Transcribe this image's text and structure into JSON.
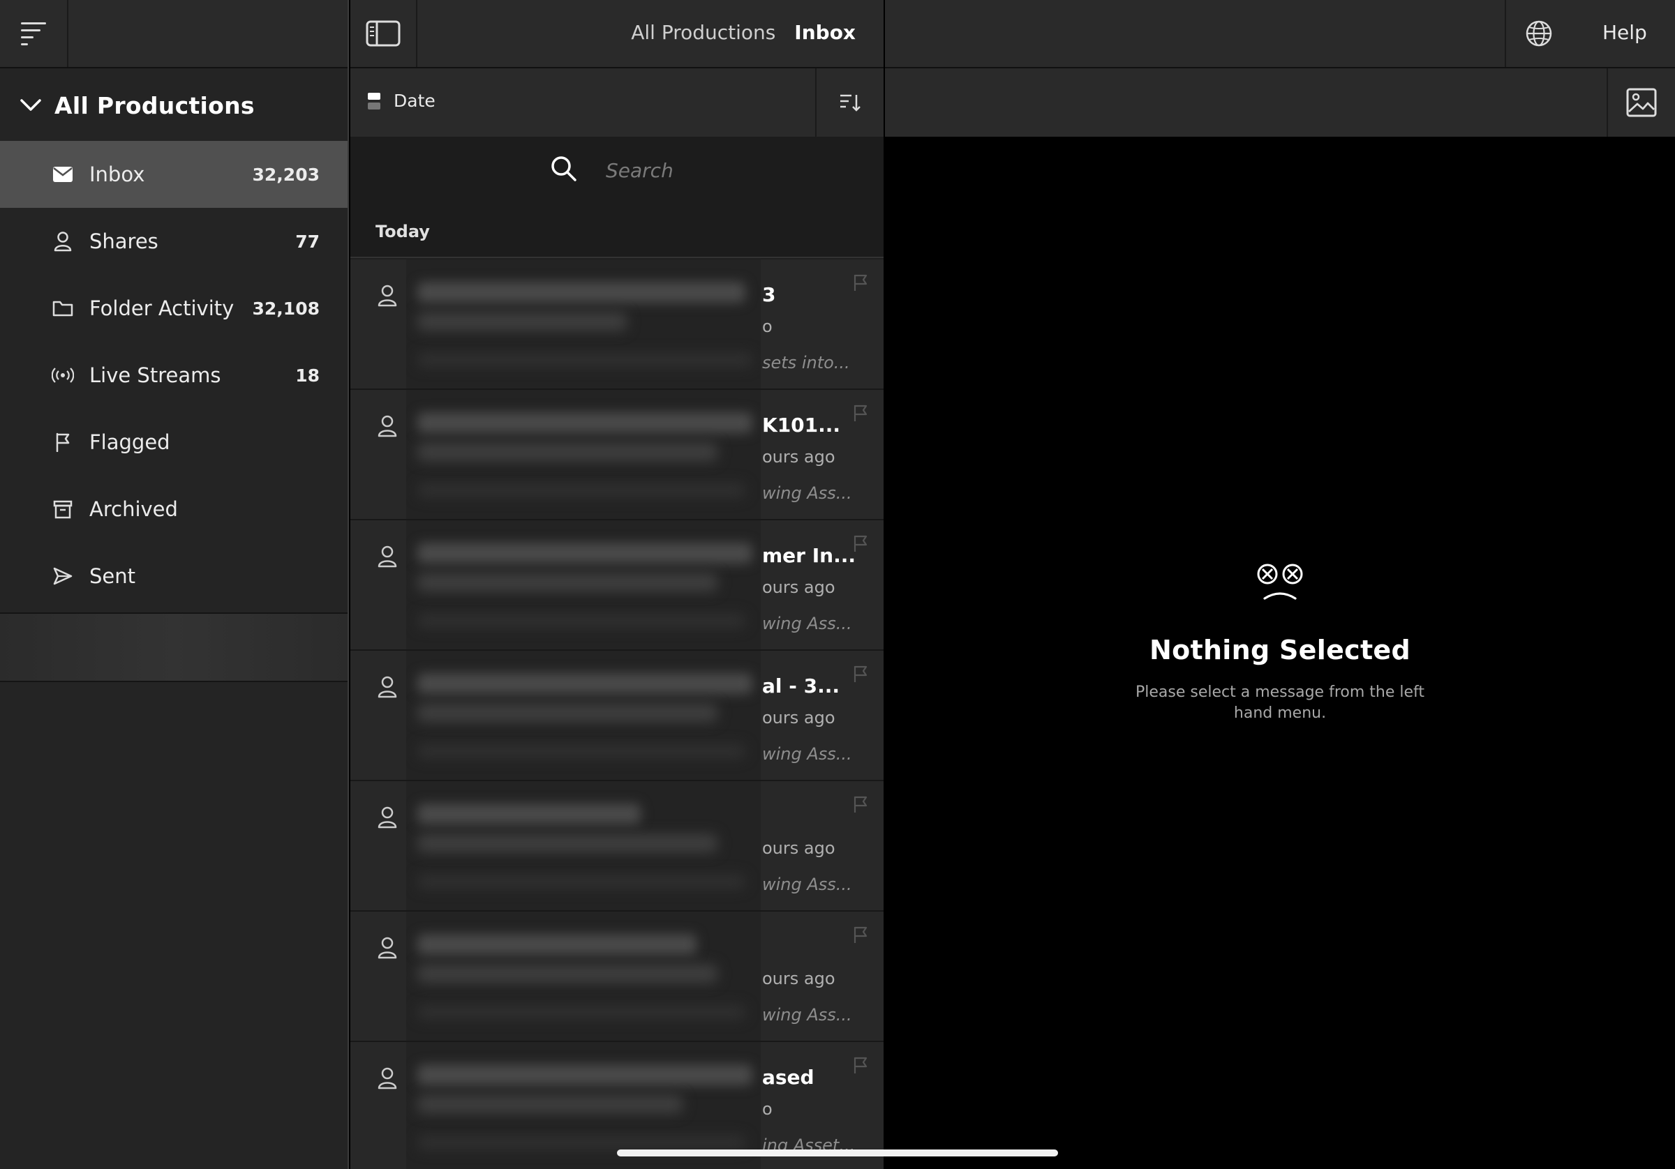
{
  "sidebar": {
    "section_title": "All Productions",
    "items": [
      {
        "label": "Inbox",
        "count": "32,203",
        "icon": "envelope-icon",
        "active": true
      },
      {
        "label": "Shares",
        "count": "77",
        "icon": "person-icon"
      },
      {
        "label": "Folder Activity",
        "count": "32,108",
        "icon": "folder-icon"
      },
      {
        "label": "Live Streams",
        "count": "18",
        "icon": "broadcast-icon"
      },
      {
        "label": "Flagged",
        "count": "",
        "icon": "flag-icon"
      },
      {
        "label": "Archived",
        "count": "",
        "icon": "archive-icon"
      },
      {
        "label": "Sent",
        "count": "",
        "icon": "send-icon"
      }
    ]
  },
  "header": {
    "breadcrumb": [
      "All Productions",
      "Inbox"
    ],
    "help_label": "Help"
  },
  "list": {
    "sort_label": "Date",
    "search_placeholder": "Search",
    "section_header": "Today",
    "messages": [
      {
        "subject": "3",
        "time": "o",
        "preview": "sets into..."
      },
      {
        "subject": "K101...",
        "time": "ours ago",
        "preview": "wing Ass..."
      },
      {
        "subject": "mer In...",
        "time": "ours ago",
        "preview": "wing Ass..."
      },
      {
        "subject": "al - 3...",
        "time": "ours ago",
        "preview": "wing Ass..."
      },
      {
        "subject": "",
        "time": "ours ago",
        "preview": "wing Ass..."
      },
      {
        "subject": "",
        "time": "ours ago",
        "preview": "wing Ass..."
      },
      {
        "subject": "ased",
        "time": "o",
        "preview": "ing Asset..."
      }
    ]
  },
  "detail": {
    "empty_title": "Nothing Selected",
    "empty_message": "Please select a message from the left hand menu."
  },
  "colors": {
    "background": "#000000",
    "panel": "#242424",
    "active_item": "#505050",
    "text": "#ffffff"
  }
}
